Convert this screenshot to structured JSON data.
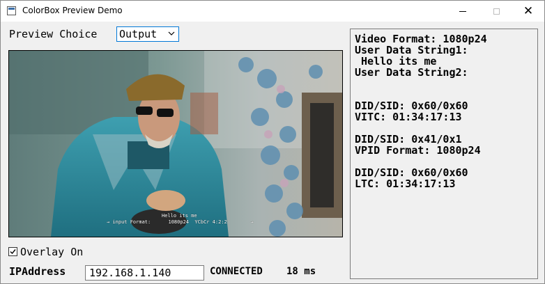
{
  "window": {
    "title": "ColorBox Preview Demo",
    "controls": [
      "minimize",
      "maximize",
      "close"
    ],
    "close_glyph": "✕"
  },
  "preview": {
    "label": "Preview Choice",
    "selected": "Output"
  },
  "video_overlay": {
    "line1": "Hello its me",
    "line2": "→ input Format:      1080p24  YCbCr 4:2:2        →"
  },
  "overlay_checkbox": {
    "label": "Overlay On",
    "checked": true
  },
  "network": {
    "ip_label": "IPAddress",
    "ip_value": "192.168.1.140",
    "status": "CONNECTED",
    "latency": "18 ms"
  },
  "info_panel": {
    "video_format": "Video Format: 1080p24",
    "user_string1_label": "User Data String1:",
    "user_string1_value": " Hello its me",
    "user_string2_label": "User Data String2:",
    "did_sid_1": "DID/SID: 0x60/0x60",
    "vitc": "VITC: 01:34:17:13",
    "did_sid_2": "DID/SID: 0x41/0x1",
    "vpid": "VPID Format: 1080p24",
    "did_sid_3": "DID/SID: 0x60/0x60",
    "ltc": "LTC: 01:34:17:13"
  },
  "icons": {
    "app": "window-icon",
    "dropdown": "chevron-down-icon",
    "check": "checkmark-icon"
  },
  "colors": {
    "accent": "#0078d7",
    "background": "#f0f0f0",
    "titlebar": "#ffffff"
  }
}
